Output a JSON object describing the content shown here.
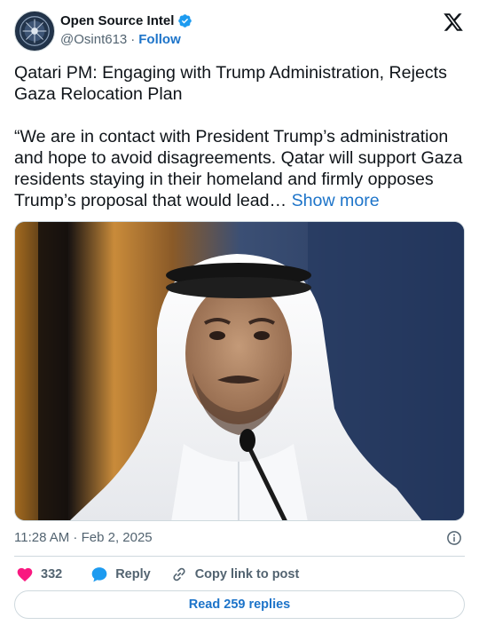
{
  "author": {
    "display_name": "Open Source Intel",
    "handle": "@Osint613",
    "separator": "·",
    "follow_label": "Follow",
    "verified": true
  },
  "tweet": {
    "title": "Qatari PM: Engaging with Trump Administration, Rejects Gaza Relocation Plan",
    "body": "“We are in contact with President Trump’s administration and hope to avoid disagreements. Qatar will support Gaza residents staying in their homeland and firmly opposes Trump’s proposal that would lead…",
    "show_more_label": "Show more",
    "timestamp": "11:28 AM · Feb 2, 2025"
  },
  "actions": {
    "like_count": "332",
    "reply_label": "Reply",
    "copy_link_label": "Copy link to post",
    "read_replies_label": "Read 259 replies"
  },
  "icons": {
    "brand": "x-logo-icon",
    "verified": "verified-badge-icon",
    "info": "info-icon",
    "like": "heart-icon",
    "reply": "speech-bubble-icon",
    "copy": "link-icon"
  },
  "colors": {
    "accent": "#1d74c9",
    "verified": "#1d9bf0",
    "heart": "#f91880",
    "muted": "#536471",
    "border": "#cfd9de"
  }
}
